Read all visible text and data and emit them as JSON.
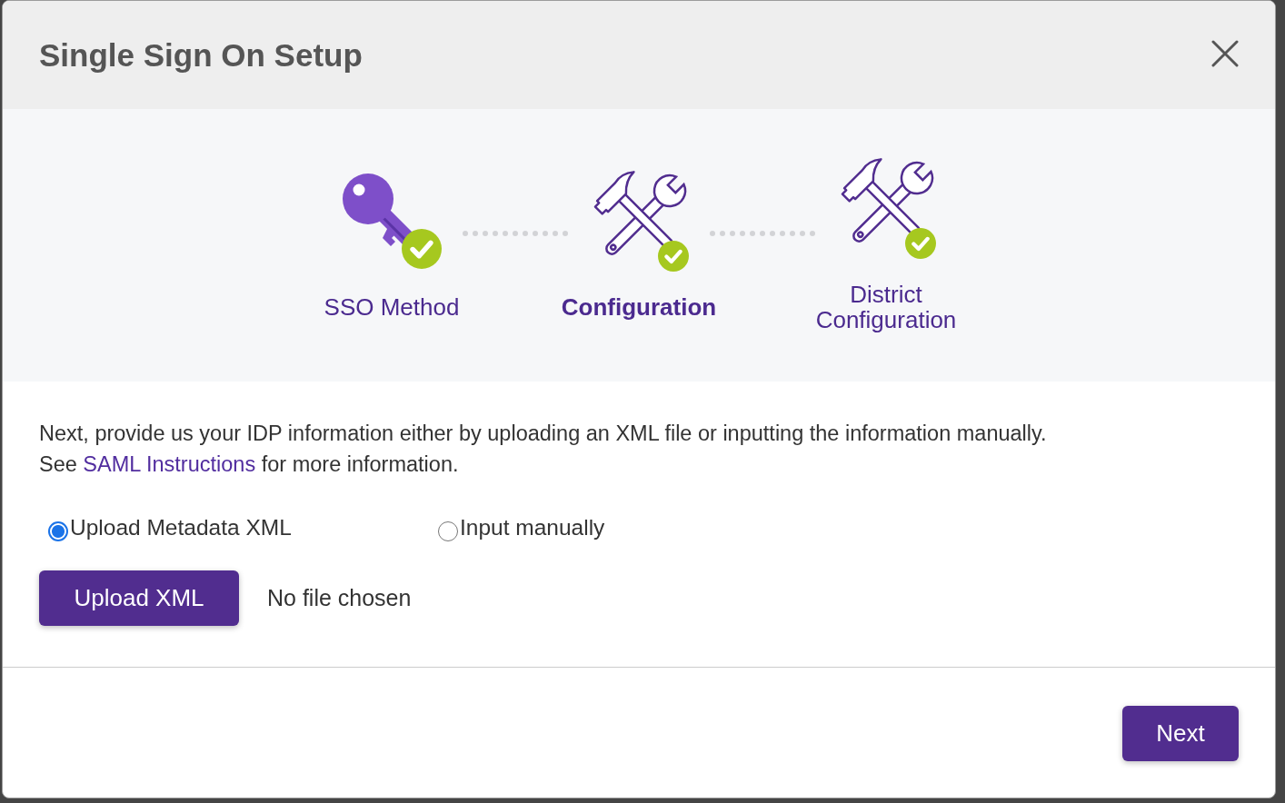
{
  "dialog": {
    "title": "Single Sign On Setup"
  },
  "steps": [
    {
      "kind": "key",
      "label": "SSO Method",
      "selected": false,
      "completed": true
    },
    {
      "kind": "tools",
      "label": "Configuration",
      "selected": true,
      "completed": true
    },
    {
      "kind": "tools",
      "label": "District Configuration",
      "selected": false,
      "completed": true
    }
  ],
  "instructions": {
    "text": "Next, provide us your IDP information either by uploading an XML file or inputting the information manually.",
    "more_info": {
      "before": "See ",
      "link": "SAML Instructions",
      "after": " for more information."
    }
  },
  "import_options": [
    {
      "label": "Upload Metadata XML",
      "selected": true
    },
    {
      "label": "Input manually",
      "selected": false
    }
  ],
  "upload": {
    "button": "Upload XML",
    "file_status": "No file chosen"
  },
  "footer": {
    "next_button": "Next"
  }
}
